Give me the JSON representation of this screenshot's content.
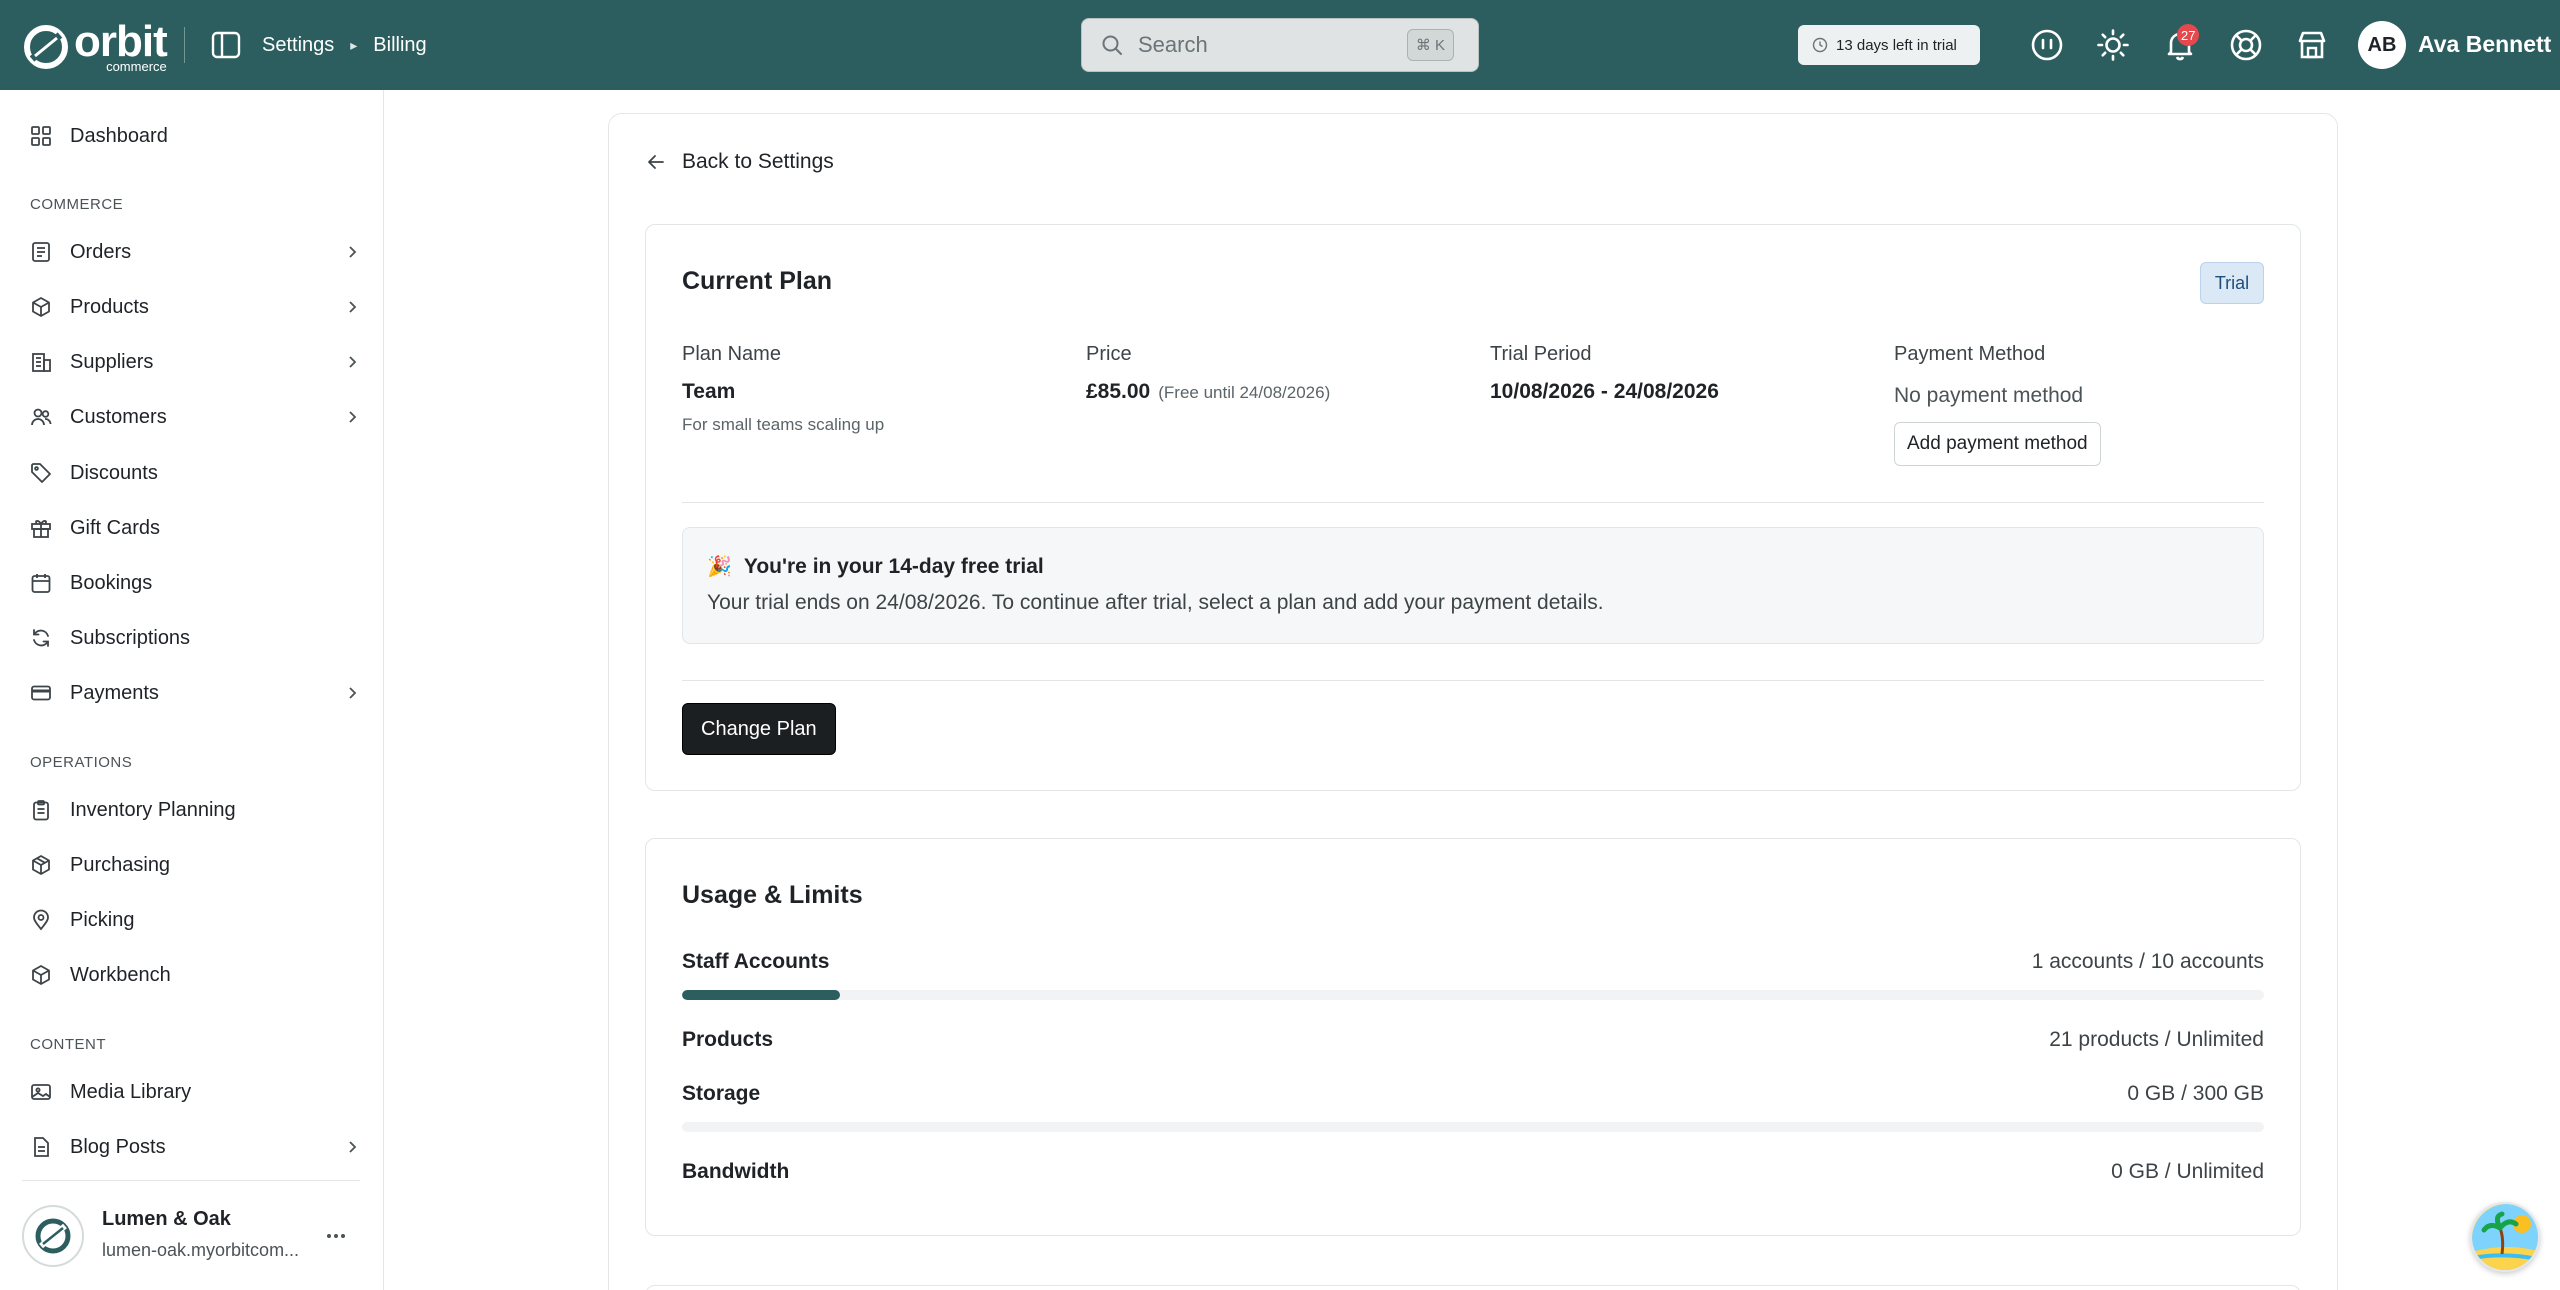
{
  "header": {
    "brand_word": "orbit",
    "brand_sub": "commerce",
    "breadcrumbs": [
      "Settings",
      "Billing"
    ],
    "search_placeholder": "Search",
    "search_shortcut": "⌘ K",
    "trial_pill": "13 days left in trial",
    "notification_count": "27",
    "user_initials": "AB",
    "user_name": "Ava Bennett",
    "accent_color": "#2d5e5f"
  },
  "sidebar": {
    "dashboard": "Dashboard",
    "sections": {
      "commerce": "COMMERCE",
      "operations": "OPERATIONS",
      "content": "CONTENT"
    },
    "items": [
      {
        "label": "Orders",
        "icon": "orders-icon",
        "has_children": true
      },
      {
        "label": "Products",
        "icon": "box-icon",
        "has_children": true
      },
      {
        "label": "Suppliers",
        "icon": "building-icon",
        "has_children": true
      },
      {
        "label": "Customers",
        "icon": "users-icon",
        "has_children": true
      },
      {
        "label": "Discounts",
        "icon": "tag-icon",
        "has_children": false
      },
      {
        "label": "Gift Cards",
        "icon": "gift-icon",
        "has_children": false
      },
      {
        "label": "Bookings",
        "icon": "calendar-icon",
        "has_children": false
      },
      {
        "label": "Subscriptions",
        "icon": "refresh-icon",
        "has_children": false
      },
      {
        "label": "Payments",
        "icon": "card-icon",
        "has_children": true
      },
      {
        "label": "Inventory Planning",
        "icon": "clipboard-icon",
        "has_children": false
      },
      {
        "label": "Purchasing",
        "icon": "cube-icon",
        "has_children": false
      },
      {
        "label": "Picking",
        "icon": "map-pin-icon",
        "has_children": false
      },
      {
        "label": "Workbench",
        "icon": "box-icon",
        "has_children": false
      },
      {
        "label": "Media Library",
        "icon": "image-icon",
        "has_children": false
      },
      {
        "label": "Blog Posts",
        "icon": "document-icon",
        "has_children": true
      }
    ],
    "workspace": {
      "name": "Lumen & Oak",
      "url": "lumen-oak.myorbitcom..."
    }
  },
  "main": {
    "back_label": "Back to Settings",
    "current_plan": {
      "title": "Current Plan",
      "badge": "Trial",
      "plan_name_label": "Plan Name",
      "plan_name": "Team",
      "plan_desc": "For small teams scaling up",
      "price_label": "Price",
      "price": "£85.00",
      "price_note": "(Free until 24/08/2026)",
      "trial_period_label": "Trial Period",
      "trial_period": "10/08/2026 - 24/08/2026",
      "payment_method_label": "Payment Method",
      "payment_method": "No payment method",
      "add_payment_button": "Add payment method",
      "banner_title": "You're in your 14-day free trial",
      "banner_text": "Your trial ends on 24/08/2026. To continue after trial, select a plan and add your payment details.",
      "change_plan_button": "Change Plan"
    },
    "usage": {
      "title": "Usage & Limits",
      "rows": [
        {
          "label": "Staff Accounts",
          "value": "1 accounts / 10 accounts",
          "fraction": 0.1
        },
        {
          "label": "Products",
          "value": "21 products / Unlimited"
        },
        {
          "label": "Storage",
          "value": "0 GB / 300 GB",
          "fraction": 0
        },
        {
          "label": "Bandwidth",
          "value": "0 GB / Unlimited"
        }
      ]
    }
  }
}
